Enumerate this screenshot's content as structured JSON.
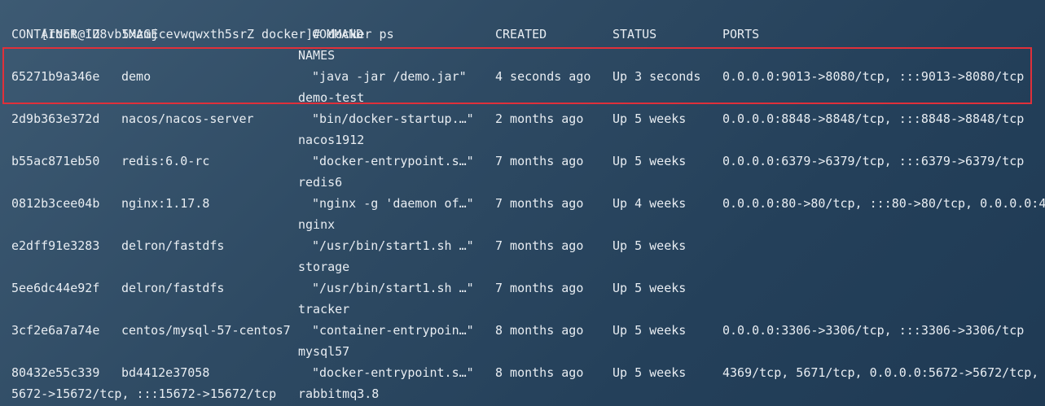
{
  "prompt": {
    "user_host_dir": "[root@iZ8vb5xzmjcevwqwxth5srZ docker]#",
    "command": "docker ps"
  },
  "headers": {
    "container_id": "CONTAINER ID",
    "image": "IMAGE",
    "command": "COMMAND",
    "created": "CREATED",
    "status": "STATUS",
    "ports": "PORTS",
    "names": "NAMES"
  },
  "containers": [
    {
      "id": "65271b9a346e",
      "image": "demo",
      "command": "\"java -jar /demo.jar\"",
      "created": "4 seconds ago",
      "status": "Up 3 seconds",
      "ports": "0.0.0.0:9013->8080/tcp, :::9013->8080/tcp",
      "name": "demo-test"
    },
    {
      "id": "2d9b363e372d",
      "image": "nacos/nacos-server",
      "command": "\"bin/docker-startup.…\"",
      "created": "2 months ago",
      "status": "Up 5 weeks",
      "ports": "0.0.0.0:8848->8848/tcp, :::8848->8848/tcp",
      "name": "nacos1912"
    },
    {
      "id": "b55ac871eb50",
      "image": "redis:6.0-rc",
      "command": "\"docker-entrypoint.s…\"",
      "created": "7 months ago",
      "status": "Up 5 weeks",
      "ports": "0.0.0.0:6379->6379/tcp, :::6379->6379/tcp",
      "name": "redis6"
    },
    {
      "id": "0812b3cee04b",
      "image": "nginx:1.17.8",
      "command": "\"nginx -g 'daemon of…\"",
      "created": "7 months ago",
      "status": "Up 4 weeks",
      "ports": "0.0.0.0:80->80/tcp, :::80->80/tcp, 0.0.0.0:4",
      "name": "nginx"
    },
    {
      "id": "e2dff91e3283",
      "image": "delron/fastdfs",
      "command": "\"/usr/bin/start1.sh …\"",
      "created": "7 months ago",
      "status": "Up 5 weeks",
      "ports": "",
      "name": "storage"
    },
    {
      "id": "5ee6dc44e92f",
      "image": "delron/fastdfs",
      "command": "\"/usr/bin/start1.sh …\"",
      "created": "7 months ago",
      "status": "Up 5 weeks",
      "ports": "",
      "name": "tracker"
    },
    {
      "id": "3cf2e6a7a74e",
      "image": "centos/mysql-57-centos7",
      "command": "\"container-entrypoin…\"",
      "created": "8 months ago",
      "status": "Up 5 weeks",
      "ports": "0.0.0.0:3306->3306/tcp, :::3306->3306/tcp",
      "name": "mysql57"
    },
    {
      "id": "80432e55c339",
      "image": "bd4412e37058",
      "command": "\"docker-entrypoint.s…\"",
      "created": "8 months ago",
      "status": "Up 5 weeks",
      "ports": "4369/tcp, 5671/tcp, 0.0.0.0:5672->5672/tcp,",
      "ports_wrap": "5672->15672/tcp, :::15672->15672/tcp",
      "name": "rabbitmq3.8"
    }
  ],
  "highlight": {
    "color": "#e0303a",
    "row_index": 0
  }
}
